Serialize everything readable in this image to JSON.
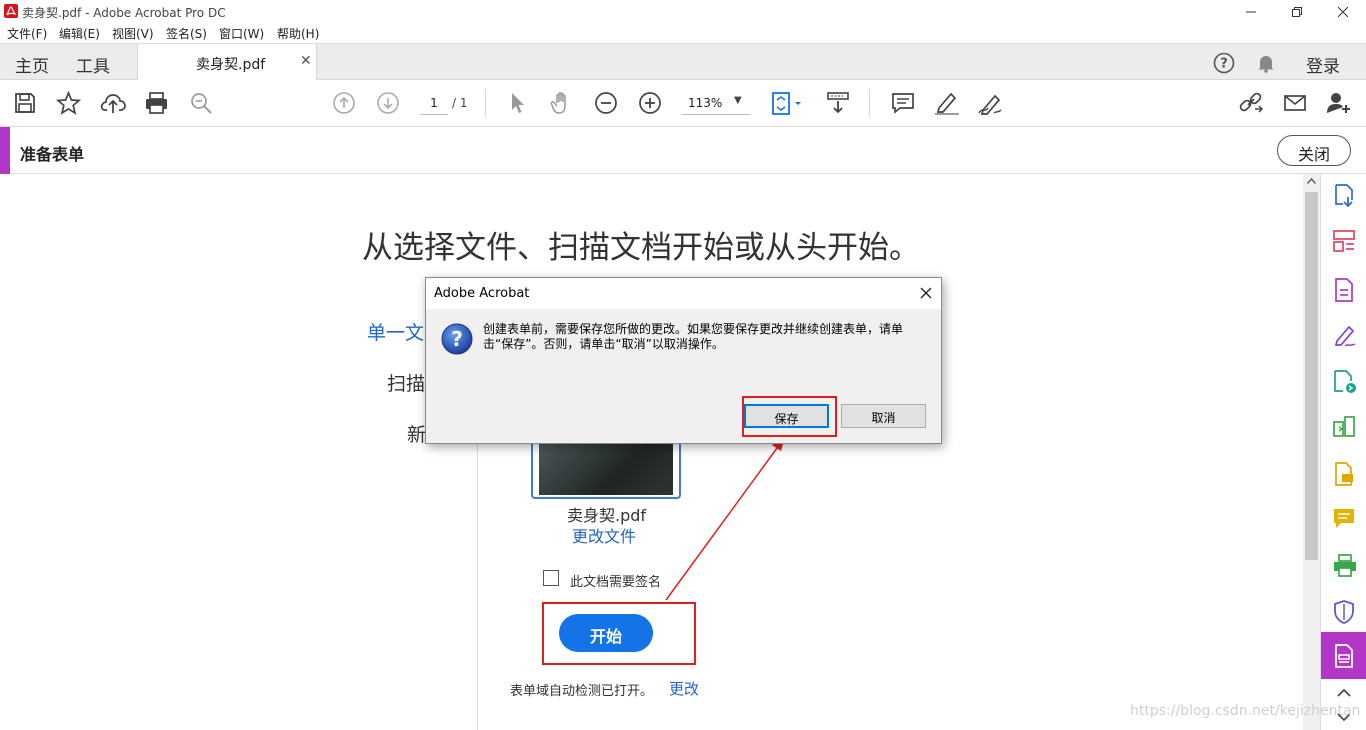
{
  "window": {
    "title": "卖身契.pdf - Adobe Acrobat Pro DC",
    "app_icon": "acrobat-icon"
  },
  "menu": [
    "文件(F)",
    "编辑(E)",
    "视图(V)",
    "签名(S)",
    "窗口(W)",
    "帮助(H)"
  ],
  "tabs": {
    "home": "主页",
    "tools": "工具",
    "document": "卖身契.pdf",
    "login": "登录"
  },
  "toolbar": {
    "page_current": "1",
    "page_total": "/ 1",
    "zoom": "113%"
  },
  "form_header": {
    "title": "准备表单",
    "close_label": "关闭",
    "accent_color": "#b236c7"
  },
  "main": {
    "headline": "从选择文件、扫描文档开始或从头开始。",
    "option_single": "单一文",
    "option_scan": "扫描",
    "option_new": "新",
    "file_name": "卖身契.pdf",
    "change_file": "更改文件",
    "checkbox_label": "此文档需要签名",
    "checkbox_checked": false,
    "start_button": "开始",
    "auto_detect": "表单域自动检测已打开。",
    "change_link": "更改"
  },
  "dialog": {
    "title": "Adobe Acrobat",
    "message": "创建表单前，需要保存您所做的更改。如果您要保存更改并继续创建表单，请单击“保存”。否则，请单击“取消”以取消操作。",
    "save_label": "保存",
    "cancel_label": "取消",
    "icon": "question-icon"
  },
  "watermark": "https://blog.csdn.net/kejizhentan",
  "colors": {
    "primary_blue": "#1473e6",
    "annotation_red": "#e02020",
    "link_blue": "#2266c8"
  }
}
